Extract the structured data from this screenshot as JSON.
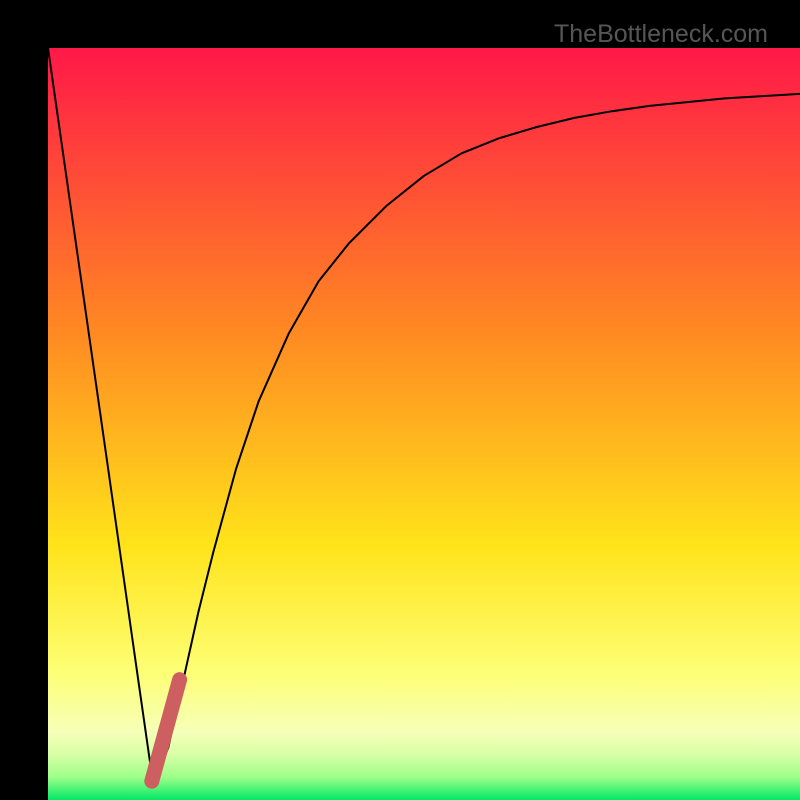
{
  "watermark": "TheBottleneck.com",
  "colors": {
    "gradient_top": "#ff1848",
    "gradient_upper": "#ff8a22",
    "gradient_mid": "#ffe31a",
    "gradient_low1": "#fdff74",
    "gradient_low2": "#f6ffb8",
    "gradient_low3": "#d7ffa6",
    "gradient_low4": "#9cff89",
    "gradient_bottom": "#00e865",
    "curve": "#000000",
    "marker": "#ce5f60",
    "frame": "#000000"
  },
  "chart_data": {
    "type": "line",
    "title": "",
    "xlabel": "",
    "ylabel": "",
    "xlim": [
      0,
      100
    ],
    "ylim": [
      0,
      100
    ],
    "series": [
      {
        "name": "bottleneck-curve",
        "x": [
          0,
          4,
          8,
          12,
          14,
          16,
          18,
          20,
          22,
          25,
          28,
          32,
          36,
          40,
          45,
          50,
          55,
          60,
          65,
          70,
          75,
          80,
          85,
          90,
          95,
          100
        ],
        "y": [
          100,
          72,
          44,
          16,
          2,
          7,
          16,
          25,
          33,
          44,
          53,
          62,
          69,
          74,
          79,
          83,
          86,
          88,
          89.5,
          90.7,
          91.6,
          92.3,
          92.8,
          93.3,
          93.6,
          93.9
        ]
      }
    ],
    "marker": {
      "name": "highlight-segment",
      "x": [
        13.8,
        17.5
      ],
      "y": [
        2.5,
        16
      ]
    }
  }
}
